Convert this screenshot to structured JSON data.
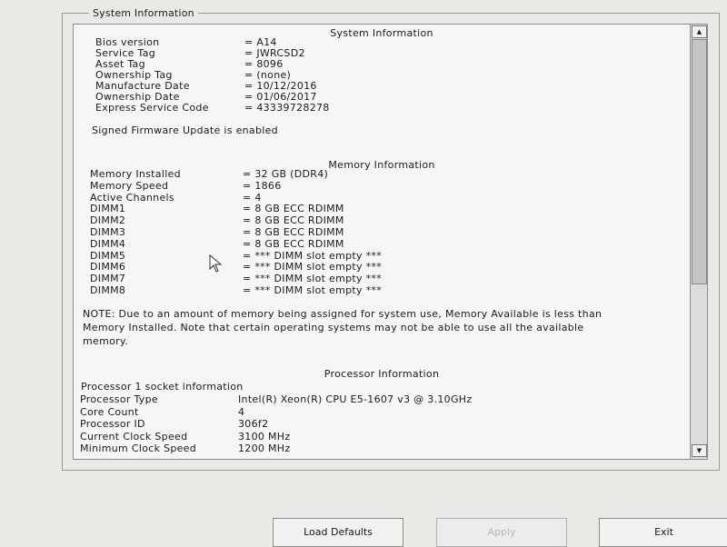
{
  "frame": {
    "title": "System Information"
  },
  "system": {
    "heading": "System Information",
    "rows": [
      {
        "label": "Bios version",
        "value": "= A14"
      },
      {
        "label": "Service Tag",
        "value": "= JWRCSD2"
      },
      {
        "label": "Asset Tag",
        "value": "= 8096"
      },
      {
        "label": "Ownership Tag",
        "value": "= (none)"
      },
      {
        "label": "Manufacture Date",
        "value": "= 10/12/2016"
      },
      {
        "label": "Ownership Date",
        "value": "= 01/06/2017"
      },
      {
        "label": "Express Service Code",
        "value": "= 43339728278"
      }
    ],
    "firmware_note": "Signed Firmware Update is enabled"
  },
  "memory": {
    "heading": "Memory Information",
    "rows": [
      {
        "label": "Memory Installed",
        "value": "= 32 GB (DDR4)"
      },
      {
        "label": "Memory Speed",
        "value": "= 1866"
      },
      {
        "label": "Active Channels",
        "value": "= 4"
      },
      {
        "label": "DIMM1",
        "value": "= 8 GB ECC RDIMM"
      },
      {
        "label": "DIMM2",
        "value": "= 8 GB ECC RDIMM"
      },
      {
        "label": "DIMM3",
        "value": "= 8 GB ECC RDIMM"
      },
      {
        "label": "DIMM4",
        "value": "= 8 GB ECC RDIMM"
      },
      {
        "label": "DIMM5",
        "value": "= *** DIMM slot empty ***"
      },
      {
        "label": "DIMM6",
        "value": "= *** DIMM slot empty ***"
      },
      {
        "label": "DIMM7",
        "value": "= *** DIMM slot empty ***"
      },
      {
        "label": "DIMM8",
        "value": "= *** DIMM slot empty ***"
      }
    ],
    "note": "NOTE: Due to an amount of memory being assigned for system use, Memory Available is less than Memory Installed. Note that certain operating systems may not be able to use all the available memory."
  },
  "processor": {
    "heading": "Processor Information",
    "socket_label": "Processor 1 socket information",
    "rows": [
      {
        "label": "Processor Type",
        "value": "Intel(R) Xeon(R) CPU E5-1607 v3 @ 3.10GHz"
      },
      {
        "label": "Core Count",
        "value": "4"
      },
      {
        "label": "Processor ID",
        "value": "306f2"
      },
      {
        "label": "Current Clock Speed",
        "value": "3100 MHz"
      },
      {
        "label": "Minimum Clock Speed",
        "value": "1200 MHz"
      }
    ]
  },
  "buttons": {
    "load_defaults": "Load Defaults",
    "apply": "Apply",
    "exit": "Exit"
  },
  "icons": {
    "scroll_up": "scroll-up-arrow-icon",
    "scroll_down": "scroll-down-arrow-icon",
    "cursor": "mouse-pointer-icon"
  }
}
